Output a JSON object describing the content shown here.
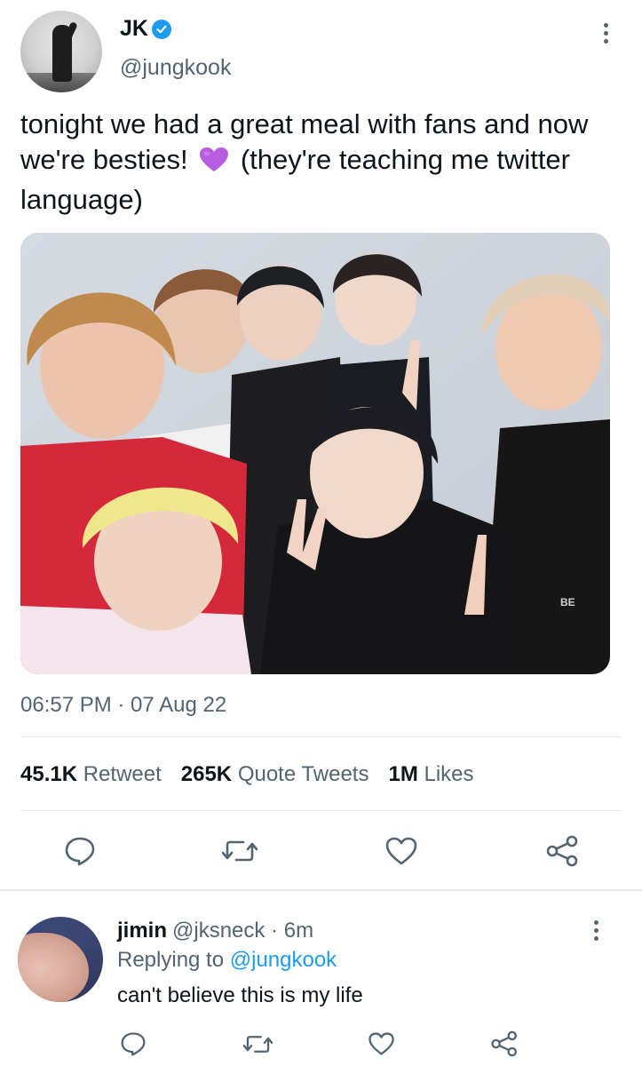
{
  "tweet": {
    "author": {
      "display_name": "JK",
      "handle": "@jungkook",
      "verified": true
    },
    "text_before_emoji": "tonight we had a great meal with fans and now we're besties!",
    "emoji": "purple-heart",
    "text_after_emoji": "(they're teaching me twitter language)",
    "timestamp": "06:57 PM · 07 Aug 22",
    "stats": [
      {
        "value": "45.1K",
        "label": "Retweet"
      },
      {
        "value": "265K",
        "label": "Quote Tweets"
      },
      {
        "value": "1M",
        "label": "Likes"
      }
    ],
    "photo_text": "BE"
  },
  "reply": {
    "author": {
      "display_name": "jimin",
      "handle_meta": "@jksneck · 6m"
    },
    "replying_prefix": "Replying to",
    "replying_to": "@jungkook",
    "text": "can't believe this is my life"
  },
  "colors": {
    "accent": "#1d9bf0",
    "text_primary": "#0f1419",
    "text_secondary": "#536471",
    "divider": "#e3e8ec",
    "heart_emoji": "#b65de0"
  }
}
